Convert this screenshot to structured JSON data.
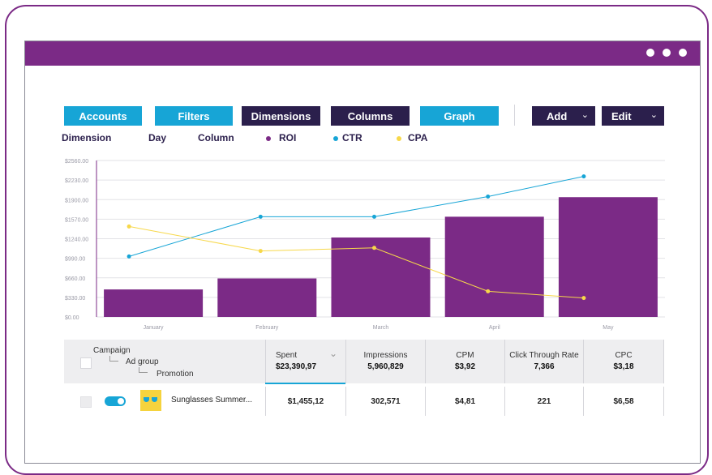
{
  "toolbar": {
    "accounts": "Accounts",
    "filters": "Filters",
    "dimensions": "Dimensions",
    "columns": "Columns",
    "graph": "Graph",
    "add": "Add",
    "edit": "Edit"
  },
  "legend": {
    "dimension": "Dimension",
    "day": "Day",
    "column": "Column",
    "roi": "ROI",
    "ctr": "CTR",
    "cpa": "CPA"
  },
  "colors": {
    "brand": "#7b2a86",
    "accent": "#17a5d6",
    "navy": "#2b1f4c",
    "cpa": "#f7d84a"
  },
  "chart_data": {
    "type": "bar",
    "categories": [
      "January",
      "February",
      "March",
      "April",
      "May"
    ],
    "y_ticks": [
      "$0.00",
      "$330.00",
      "$660.00",
      "$990.00",
      "$1240.00",
      "$1570.00",
      "$1900.00",
      "$2230.00",
      "$2560.00"
    ],
    "ylim": [
      0,
      2560
    ],
    "grid": true,
    "series": [
      {
        "name": "ROI",
        "kind": "bar",
        "color": "#7b2a86",
        "values": [
          450,
          630,
          1300,
          1640,
          1960
        ]
      },
      {
        "name": "CTR",
        "kind": "line",
        "color": "#17a5d6",
        "values": [
          990,
          1640,
          1640,
          1970,
          2300
        ]
      },
      {
        "name": "CPA",
        "kind": "line",
        "color": "#f7d84a",
        "values": [
          1480,
          1080,
          1130,
          420,
          310
        ]
      }
    ]
  },
  "table": {
    "campaign": "Campaign",
    "ad_group": "Ad group",
    "promotion": "Promotion",
    "columns": [
      {
        "title": "Spent",
        "total": "$23,390,97"
      },
      {
        "title": "Impressions",
        "total": "5,960,829"
      },
      {
        "title": "CPM",
        "total": "$3,92"
      },
      {
        "title": "Click Through Rate",
        "total": "7,366"
      },
      {
        "title": "CPC",
        "total": "$3,18"
      }
    ],
    "rows": [
      {
        "name": "Sunglasses Summer...",
        "values": [
          "$1,455,12",
          "302,571",
          "$4,81",
          "221",
          "$6,58"
        ]
      }
    ]
  }
}
